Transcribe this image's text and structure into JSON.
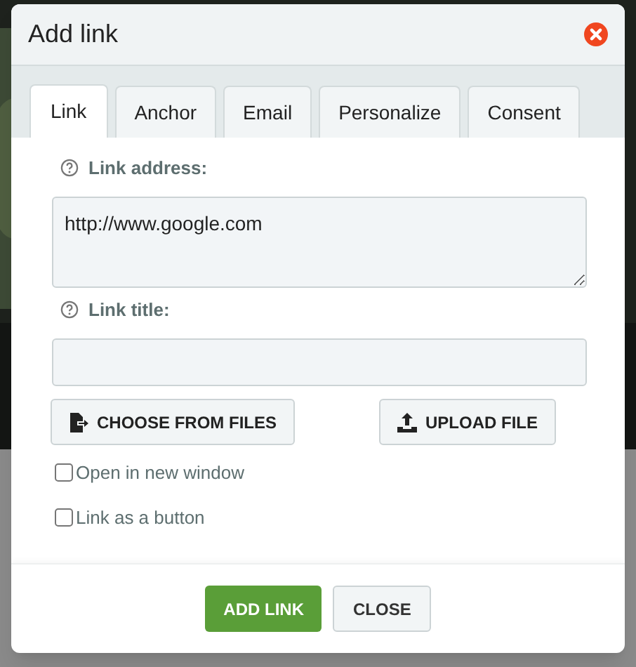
{
  "dialog": {
    "title": "Add link"
  },
  "tabs": [
    {
      "label": "Link",
      "selected": true
    },
    {
      "label": "Anchor",
      "selected": false
    },
    {
      "label": "Email",
      "selected": false
    },
    {
      "label": "Personalize",
      "selected": false
    },
    {
      "label": "Consent",
      "selected": false
    }
  ],
  "link_address": {
    "label": "Link address:",
    "value": "http://www.google.com"
  },
  "link_title": {
    "label": "Link title:"
  },
  "file_buttons": [
    {
      "kind": "choose",
      "label": "CHOOSE FROM FILES"
    },
    {
      "kind": "upload",
      "label": "UPLOAD FILE"
    }
  ],
  "options": [
    {
      "label": "Open in new window",
      "checked": false
    },
    {
      "label": "Link as a button",
      "checked": false
    }
  ],
  "footer_buttons": [
    {
      "kind": "primary",
      "label": "ADD LINK"
    },
    {
      "kind": "secondary",
      "label": "CLOSE"
    }
  ]
}
